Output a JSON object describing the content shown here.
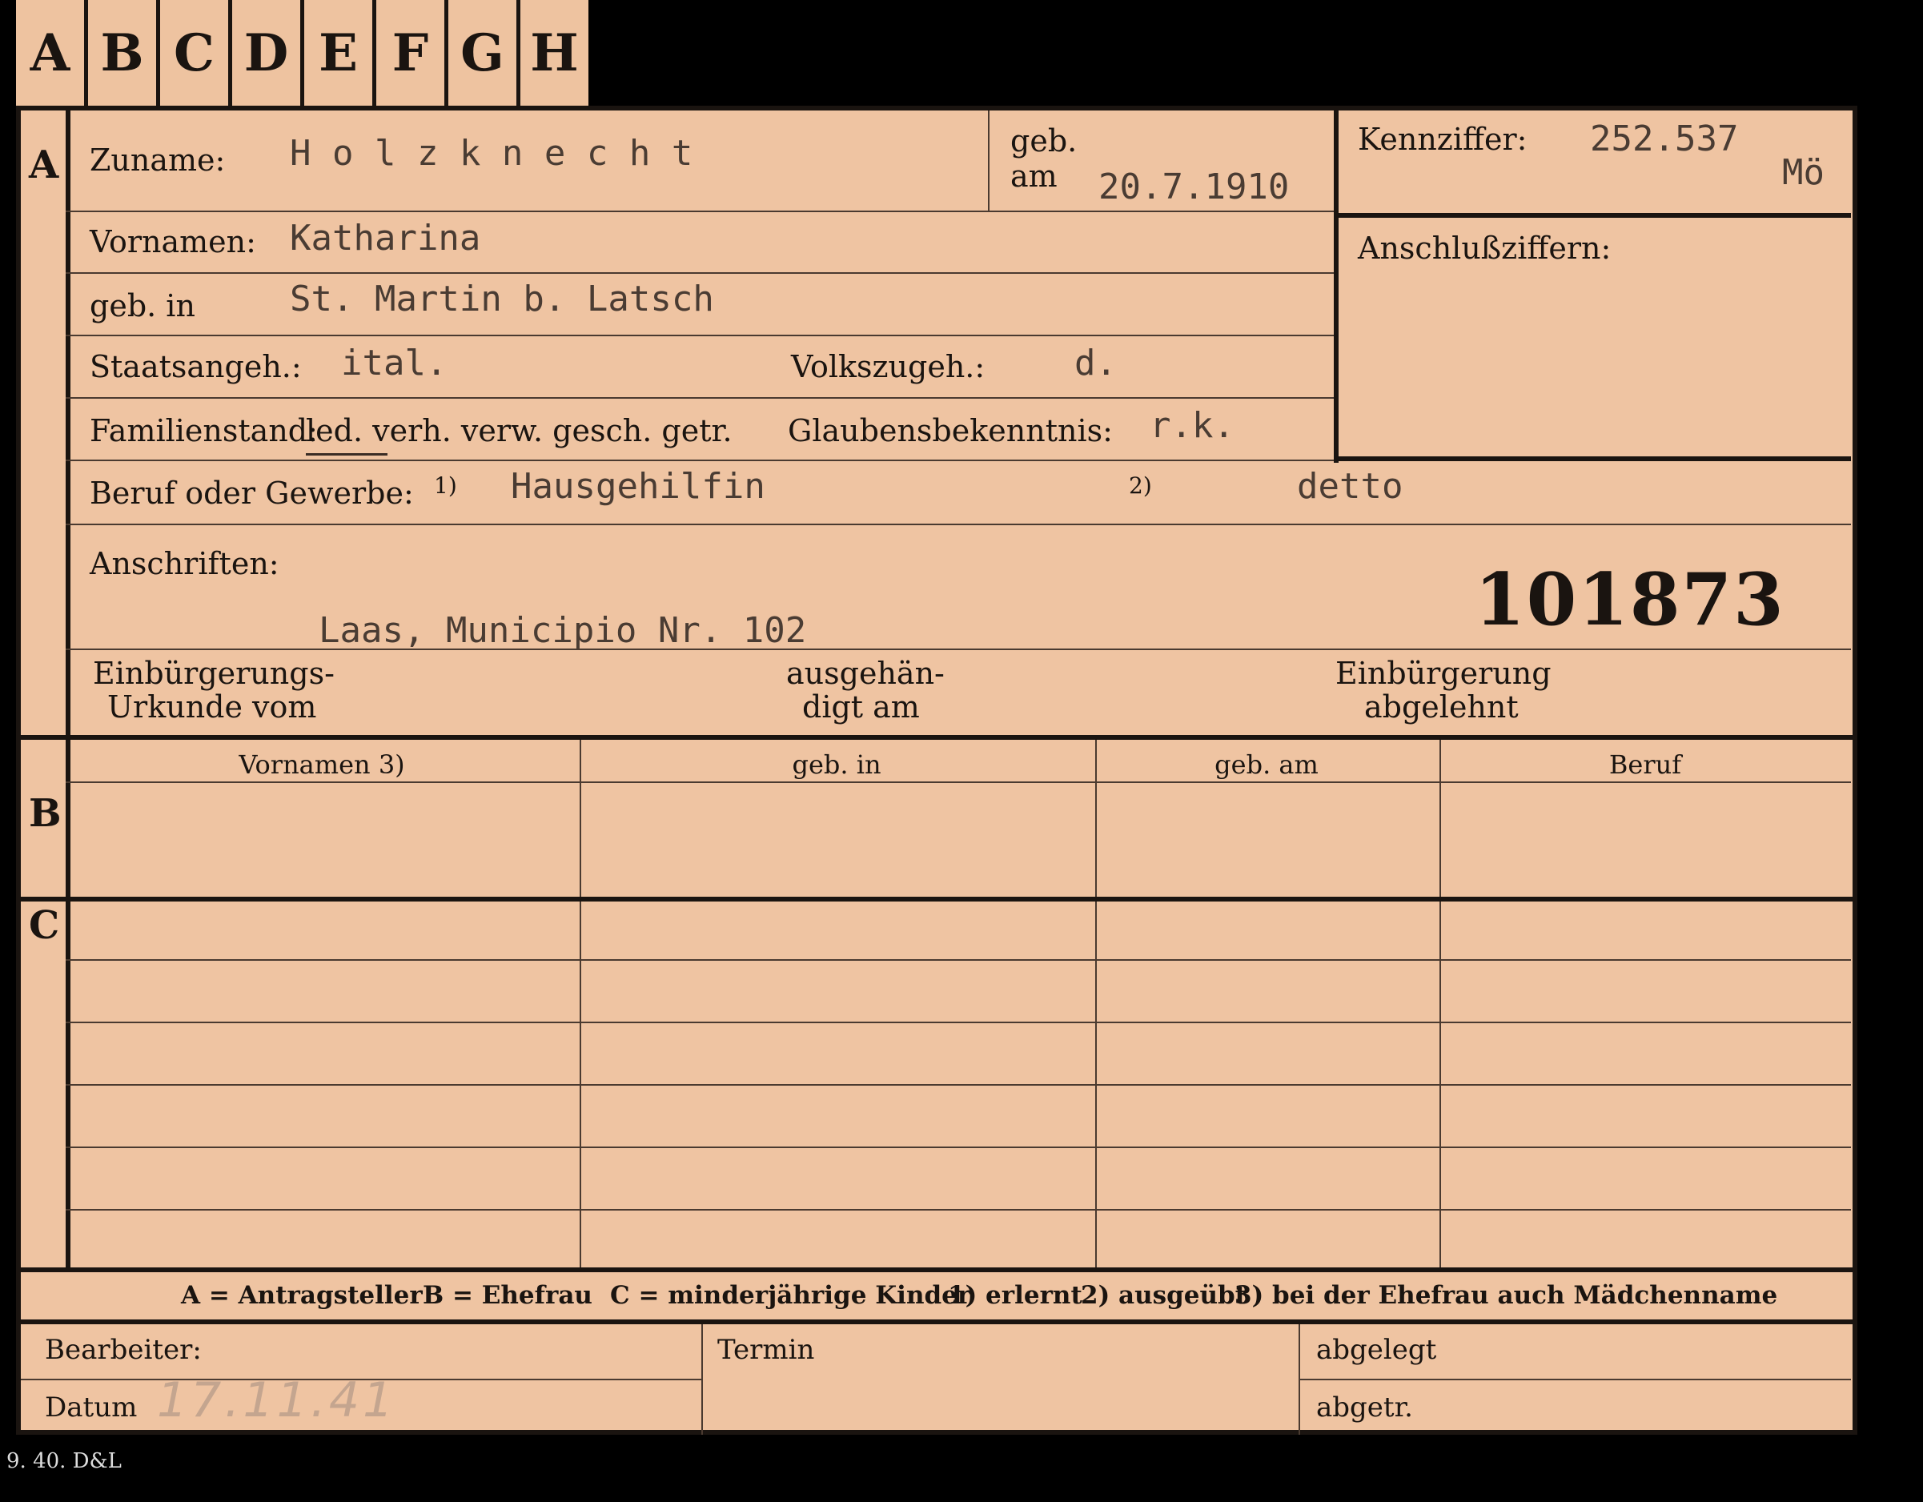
{
  "tabs": [
    "A",
    "B",
    "C",
    "D",
    "E",
    "F",
    "G",
    "H"
  ],
  "sections": {
    "a": "A",
    "b": "B",
    "c": "C"
  },
  "labels": {
    "zuname": "Zuname:",
    "geb_am": "geb.\nam",
    "kennziffer": "Kennziffer:",
    "anschlussziffern": "Anschlußziffern:",
    "vornamen": "Vornamen:",
    "geb_in": "geb. in",
    "staatsangeh": "Staatsangeh.:",
    "volkszugeh": "Volkszugeh.:",
    "familienstand": "Familienstand:",
    "familienstand_options": "led. verh. verw. gesch. getr.",
    "glaubensbekenntnis": "Glaubensbekenntnis:",
    "beruf": "Beruf oder Gewerbe:",
    "beruf_note1": "1)",
    "beruf_note2": "2)",
    "anschriften": "Anschriften:",
    "einbuergerung_urkunde_1": "Einbürgerungs-",
    "einbuergerung_urkunde_2": "Urkunde vom",
    "ausgehaendigt_1": "ausgehän-",
    "ausgehaendigt_2": "digt am",
    "einbuergerung_abgelehnt_1": "Einbürgerung",
    "einbuergerung_abgelehnt_2": "abgelehnt",
    "bearbeiter": "Bearbeiter:",
    "termin": "Termin",
    "abgelegt": "abgelegt",
    "datum": "Datum",
    "abgetr": "abgetr."
  },
  "values": {
    "zuname": "H o l z k n e c h t",
    "geb_am": "20.7.1910",
    "kennziffer": "252.537",
    "kennziffer_suffix": "Mö",
    "vornamen": "Katharina",
    "geb_in": "St. Martin b. Latsch",
    "staatsangeh": "ital.",
    "volkszugeh": "d.",
    "glaubensbekenntnis": "r.k.",
    "beruf_erlernt": "Hausgehilfin",
    "beruf_ausgeuebt": "detto",
    "anschrift": "Laas, Municipio Nr. 102",
    "stamp_number": "101873",
    "datum_handwritten": "17.11.41"
  },
  "table": {
    "headers": [
      "Vornamen 3)",
      "geb. in",
      "geb. am",
      "Beruf"
    ]
  },
  "legend": {
    "a": "A = Antragsteller",
    "b": "B = Ehefrau",
    "c": "C = minderjährige Kinder",
    "n1": "1) erlernt",
    "n2": "2) ausgeübt",
    "n3": "3) bei der Ehefrau auch Mädchenname"
  },
  "footer_code": "9. 40. D&L"
}
